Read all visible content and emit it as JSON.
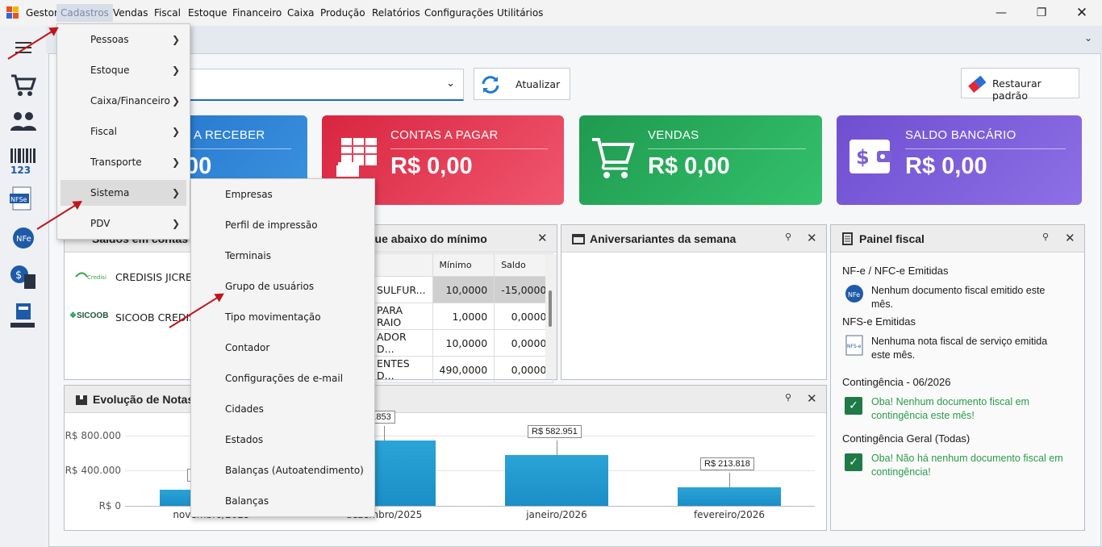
{
  "menubar": {
    "app": "Gestor",
    "items": [
      "Cadastros",
      "Vendas",
      "Fiscal",
      "Estoque",
      "Financeiro",
      "Caixa",
      "Produção",
      "Relatórios",
      "Configurações",
      "Utilitários"
    ]
  },
  "toolbar": {
    "refresh_label": "Atualizar",
    "restore_label": "Restaurar padrão"
  },
  "kpis": [
    {
      "label": "A RECEBER",
      "value": "00"
    },
    {
      "label": "CONTAS A PAGAR",
      "value": "R$ 0,00"
    },
    {
      "label": "VENDAS",
      "value": "R$ 0,00"
    },
    {
      "label": "SALDO BANCÁRIO",
      "value": "R$ 0,00"
    }
  ],
  "cadastros_menu": [
    "Pessoas",
    "Estoque",
    "Caixa/Financeiro",
    "Fiscal",
    "Transporte",
    "Sistema",
    "PDV"
  ],
  "sistema_menu": [
    "Empresas",
    "Perfil de impressão",
    "Terminais",
    "Grupo de usuários",
    "Tipo movimentação",
    "Contador",
    "Configurações de e-mail",
    "Cidades",
    "Estados",
    "Balanças (Autoatendimento)",
    "Balanças"
  ],
  "saldos": {
    "title": "Saldos em contas",
    "rows": [
      {
        "bank": "CREDISIS JICRED",
        "logo": "Credisis"
      },
      {
        "bank": "SICOOB CREDISU",
        "logo": "SICOOB"
      }
    ]
  },
  "estoque": {
    "title": "que abaixo do mínimo",
    "headers": [
      "Mínimo",
      "Saldo"
    ],
    "rows": [
      {
        "name": "SULFUR...",
        "min": "10,0000",
        "saldo": "-15,0000"
      },
      {
        "name": "PARA RAIO",
        "min": "1,0000",
        "saldo": "0,0000"
      },
      {
        "name": "ADOR D...",
        "min": "10,0000",
        "saldo": "0,0000"
      },
      {
        "name": "ENTES D...",
        "min": "490,0000",
        "saldo": "0,0000"
      }
    ]
  },
  "aniversariantes": {
    "title": "Aniversariantes da semana"
  },
  "fiscal": {
    "title": "Painel fiscal",
    "nfe_heading": "NF-e / NFC-e Emitidas",
    "nfe_text": "Nenhum documento fiscal emitido este mês.",
    "nfse_heading": "NFS-e Emitidas",
    "nfse_text": "Nenhuma nota fiscal de serviço emitida este mês.",
    "cont_heading": "Contingência - 06/2026",
    "cont_text": "Oba! Nenhum documento fiscal em contingência este mês!",
    "contg_heading": "Contingência Geral (Todas)",
    "contg_text": "Oba! Não há nenhum documento fiscal em contingência!"
  },
  "evolucao": {
    "title": "Evolução de Notas"
  },
  "chart_data": {
    "type": "bar",
    "categories": [
      "novembro/2025",
      "dezembro/2025",
      "janeiro/2026",
      "fevereiro/2026"
    ],
    "values": [
      180000,
      742853,
      582951,
      213818
    ],
    "data_labels": [
      "",
      "742.853",
      "R$ 582.951",
      "R$ 213.818"
    ],
    "yticks": [
      "R$ 800.000",
      "R$ 400.000",
      "R$ 0"
    ],
    "ylim": [
      0,
      800000
    ]
  },
  "colors": {
    "receber": "#2f86d3",
    "pagar": "#e53956",
    "vendas": "#27a95a",
    "saldo": "#7b5fd6",
    "bar": "#1f9ad0"
  }
}
